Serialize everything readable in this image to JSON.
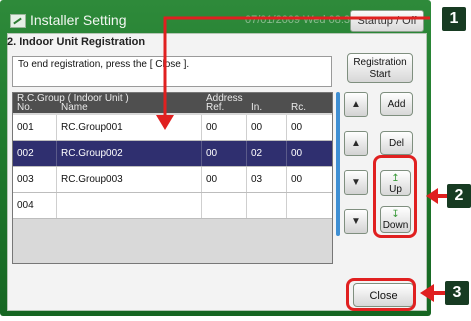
{
  "window": {
    "title": "Installer Setting",
    "datetime": "07/01/2009 Wed 08:30 PM",
    "startup_button": "Startup / Off"
  },
  "section": {
    "title": "2. Indoor Unit Registration",
    "message": "To end registration, press the [ Close ]."
  },
  "table": {
    "headers": {
      "group": "R.C.Group ( Indoor Unit )",
      "no": "No.",
      "name": "Name",
      "address": "Address",
      "ref": "Ref.",
      "in": "In.",
      "rc": "Rc."
    },
    "rows": [
      {
        "no": "001",
        "name": "RC.Group001",
        "ref": "00",
        "in": "00",
        "rc": "00"
      },
      {
        "no": "002",
        "name": "RC.Group002",
        "ref": "00",
        "in": "02",
        "rc": "00"
      },
      {
        "no": "003",
        "name": "RC.Group003",
        "ref": "00",
        "in": "03",
        "rc": "00"
      },
      {
        "no": "004",
        "name": "",
        "ref": "",
        "in": "",
        "rc": ""
      }
    ],
    "selected_index": 1
  },
  "buttons": {
    "registration_start_1": "Registration",
    "registration_start_2": "Start",
    "add": "Add",
    "del": "Del",
    "up": "Up",
    "down": "Down",
    "close": "Close"
  },
  "annotations": {
    "callout_1": "1",
    "callout_2": "2",
    "callout_3": "3",
    "highlight_color": "#e02020",
    "badge_color": "#173b22"
  },
  "icons": {
    "title_icon": "installer-settings-icon",
    "scroll_top": "double-up-arrow-icon",
    "scroll_up": "up-arrow-icon",
    "scroll_down": "down-arrow-icon",
    "scroll_bottom": "double-down-arrow-icon",
    "move_up": "move-up-icon",
    "move_down": "move-down-icon"
  }
}
